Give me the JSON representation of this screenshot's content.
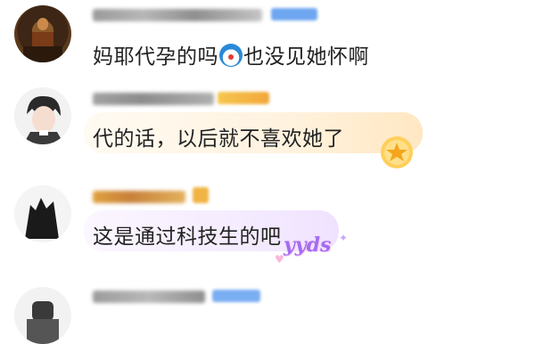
{
  "comments": [
    {
      "text_a": "妈耶代孕的吗",
      "emoji": "doraemon-emoji",
      "text_b": "也没见她怀啊"
    },
    {
      "text": "代的话，以后就不喜欢她了",
      "sticker": "gold-star-badge"
    },
    {
      "text": "这是通过科技生的吧",
      "sticker_text": "yyds"
    },
    {
      "text": ""
    }
  ]
}
